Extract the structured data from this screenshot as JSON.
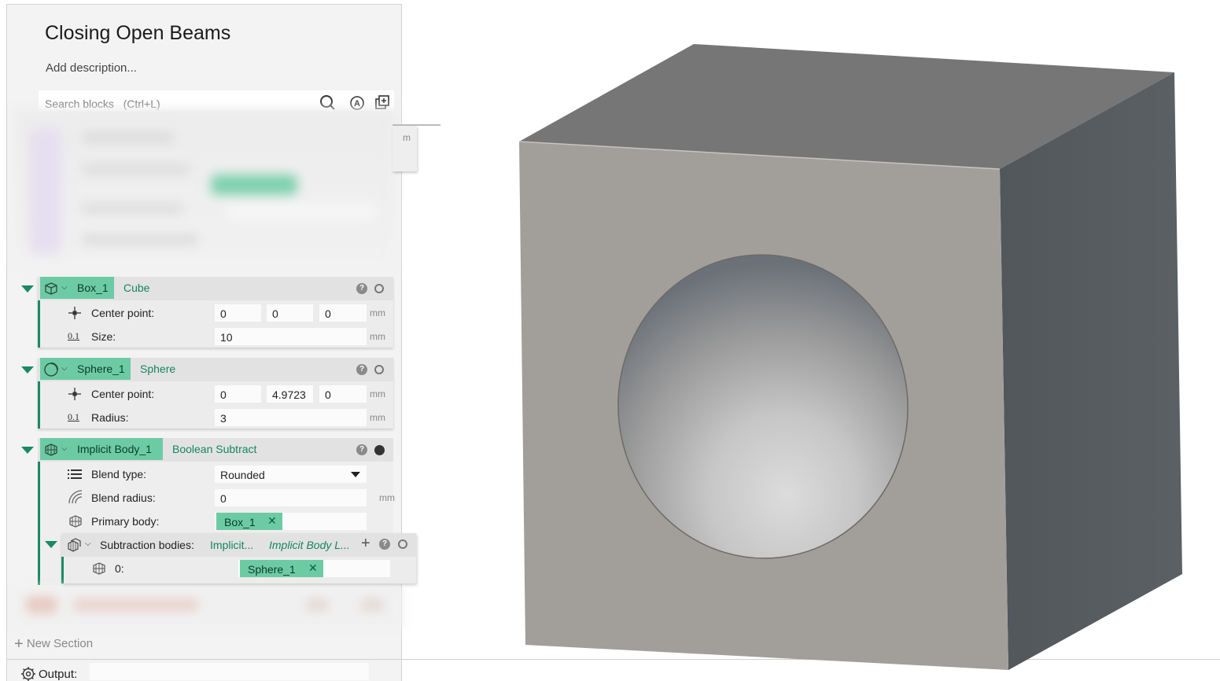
{
  "page": {
    "title": "Closing Open Beams",
    "description_placeholder": "Add description...",
    "search_placeholder": "Search blocks   (Ctrl+L)"
  },
  "stub_unit": "m",
  "blocks": {
    "box": {
      "name": "Box_1",
      "type": "Cube",
      "center_label": "Center point:",
      "center": [
        "0",
        "0",
        "0"
      ],
      "center_unit": "mm",
      "size_label": "Size:",
      "size": "10",
      "size_unit": "mm",
      "input_icon_text": "0.1"
    },
    "sphere": {
      "name": "Sphere_1",
      "type": "Sphere",
      "center_label": "Center point:",
      "center": [
        "0",
        "4.9723",
        "0"
      ],
      "center_unit": "mm",
      "radius_label": "Radius:",
      "radius": "3",
      "radius_unit": "mm",
      "input_icon_text": "0.1"
    },
    "implicit": {
      "name": "Implicit Body_1",
      "type": "Boolean Subtract",
      "blend_type_label": "Blend type:",
      "blend_type": "Rounded",
      "blend_radius_label": "Blend radius:",
      "blend_radius": "0",
      "blend_radius_unit": "mm",
      "primary_label": "Primary body:",
      "primary": "Box_1",
      "subtraction_label": "Subtraction bodies:",
      "subtraction_type": "Implicit...",
      "subtraction_list_type": "Implicit Body L...",
      "item_index": "0:",
      "item": "Sphere_1"
    }
  },
  "footer": {
    "new_section": "New Section",
    "output_label": "Output:"
  },
  "colors": {
    "accent_green": "#1a8a63",
    "chip_green": "#6dcba4",
    "cube_front": "#a09d99",
    "cube_top": "#777777",
    "cube_side": "#555a5e"
  }
}
